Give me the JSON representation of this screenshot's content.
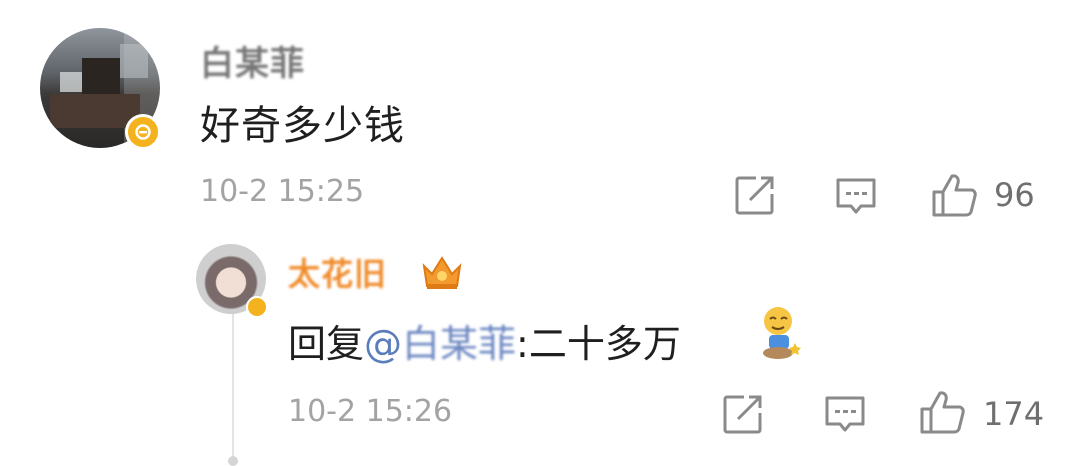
{
  "comment": {
    "author": "白某菲",
    "text": "好奇多少钱",
    "time": "10-2 15:25",
    "like_count": "96",
    "icons": {
      "share": "share-edit-icon",
      "comment": "comment-icon",
      "like": "thumbs-up-icon",
      "verified": "verified-badge-icon"
    }
  },
  "reply": {
    "author": "太花旧",
    "reply_prefix": "回复",
    "mention_at": "@",
    "mention_name": "白某菲",
    "colon": ":",
    "text": "二十多万",
    "emoji": "kneeling-figure-emoji",
    "time": "10-2 15:26",
    "like_count": "174",
    "icons": {
      "crown": "crown-badge-icon",
      "share": "share-edit-icon",
      "comment": "comment-icon",
      "like": "thumbs-up-icon",
      "verified": "verified-badge-icon"
    }
  },
  "colors": {
    "name_gold": "#f08a2a",
    "mention_blue": "#5b7dbb",
    "verified_yellow": "#f4b31e",
    "meta_gray": "#a3a3a3"
  }
}
